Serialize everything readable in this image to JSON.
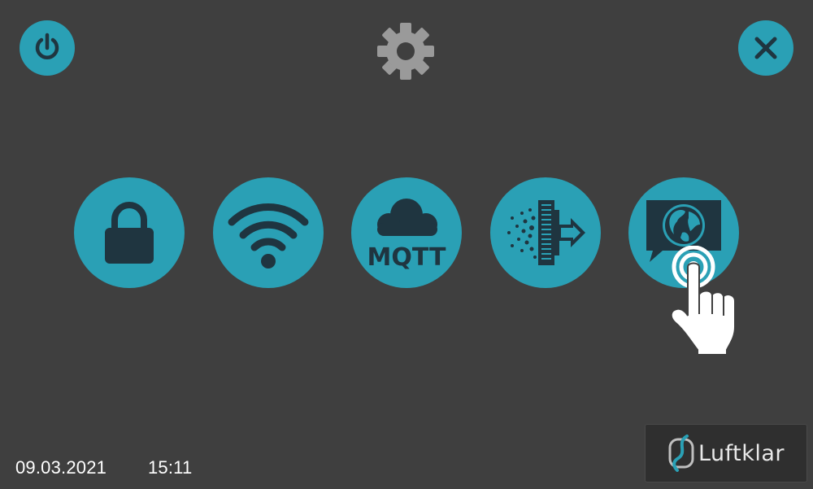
{
  "header": {
    "power_icon": "power-icon",
    "settings_icon": "gear-icon",
    "close_icon": "close-icon"
  },
  "menu": {
    "items": [
      {
        "name": "lock",
        "icon": "lock-icon"
      },
      {
        "name": "wifi",
        "icon": "wifi-icon"
      },
      {
        "name": "mqtt",
        "icon": "cloud-mqtt-icon",
        "label": "MQTT"
      },
      {
        "name": "filter",
        "icon": "filter-arrow-icon"
      },
      {
        "name": "language",
        "icon": "globe-chat-icon"
      }
    ]
  },
  "footer": {
    "date": "09.03.2021",
    "time": "15:11"
  },
  "brand": {
    "name": "Luftklar"
  },
  "colors": {
    "background": "#3f3f3f",
    "accent": "#2aa0b5",
    "icon_dark": "#1f3540",
    "gear": "#9a9a9a"
  }
}
